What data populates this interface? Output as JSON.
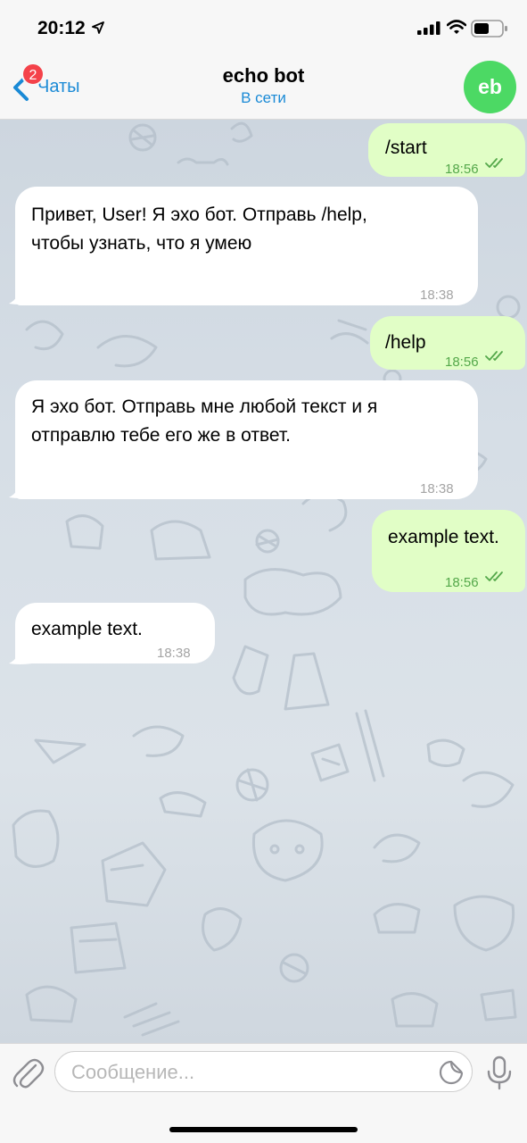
{
  "status_bar": {
    "time": "20:12"
  },
  "nav": {
    "back_label": "Чаты",
    "unread_badge": "2",
    "title": "echo bot",
    "subtitle": "В сети",
    "avatar_initials": "eb"
  },
  "messages": [
    {
      "direction": "out",
      "text": "/start",
      "time": "18:56",
      "status": "read"
    },
    {
      "direction": "in",
      "text_lines": [
        "Привет, User! Я эхо бот. Отправь /help,",
        "чтобы узнать, что я умею"
      ],
      "time": "18:38"
    },
    {
      "direction": "out",
      "text": "/help",
      "time": "18:56",
      "status": "read"
    },
    {
      "direction": "in",
      "text_lines": [
        "Я эхо бот. Отправь мне любой текст и я",
        "отправлю тебе его же в ответ."
      ],
      "time": "18:38"
    },
    {
      "direction": "out",
      "text": "example text.",
      "time": "18:56",
      "status": "read"
    },
    {
      "direction": "in",
      "text": "example text.",
      "time": "18:38"
    }
  ],
  "input": {
    "placeholder": "Сообщение..."
  },
  "colors": {
    "accent": "#1a8ad6",
    "outgoing_bubble": "#e1fec6",
    "incoming_bubble": "#ffffff",
    "read_ticks": "#54a84a",
    "badge": "#f4424a",
    "avatar": "#4cd964"
  }
}
